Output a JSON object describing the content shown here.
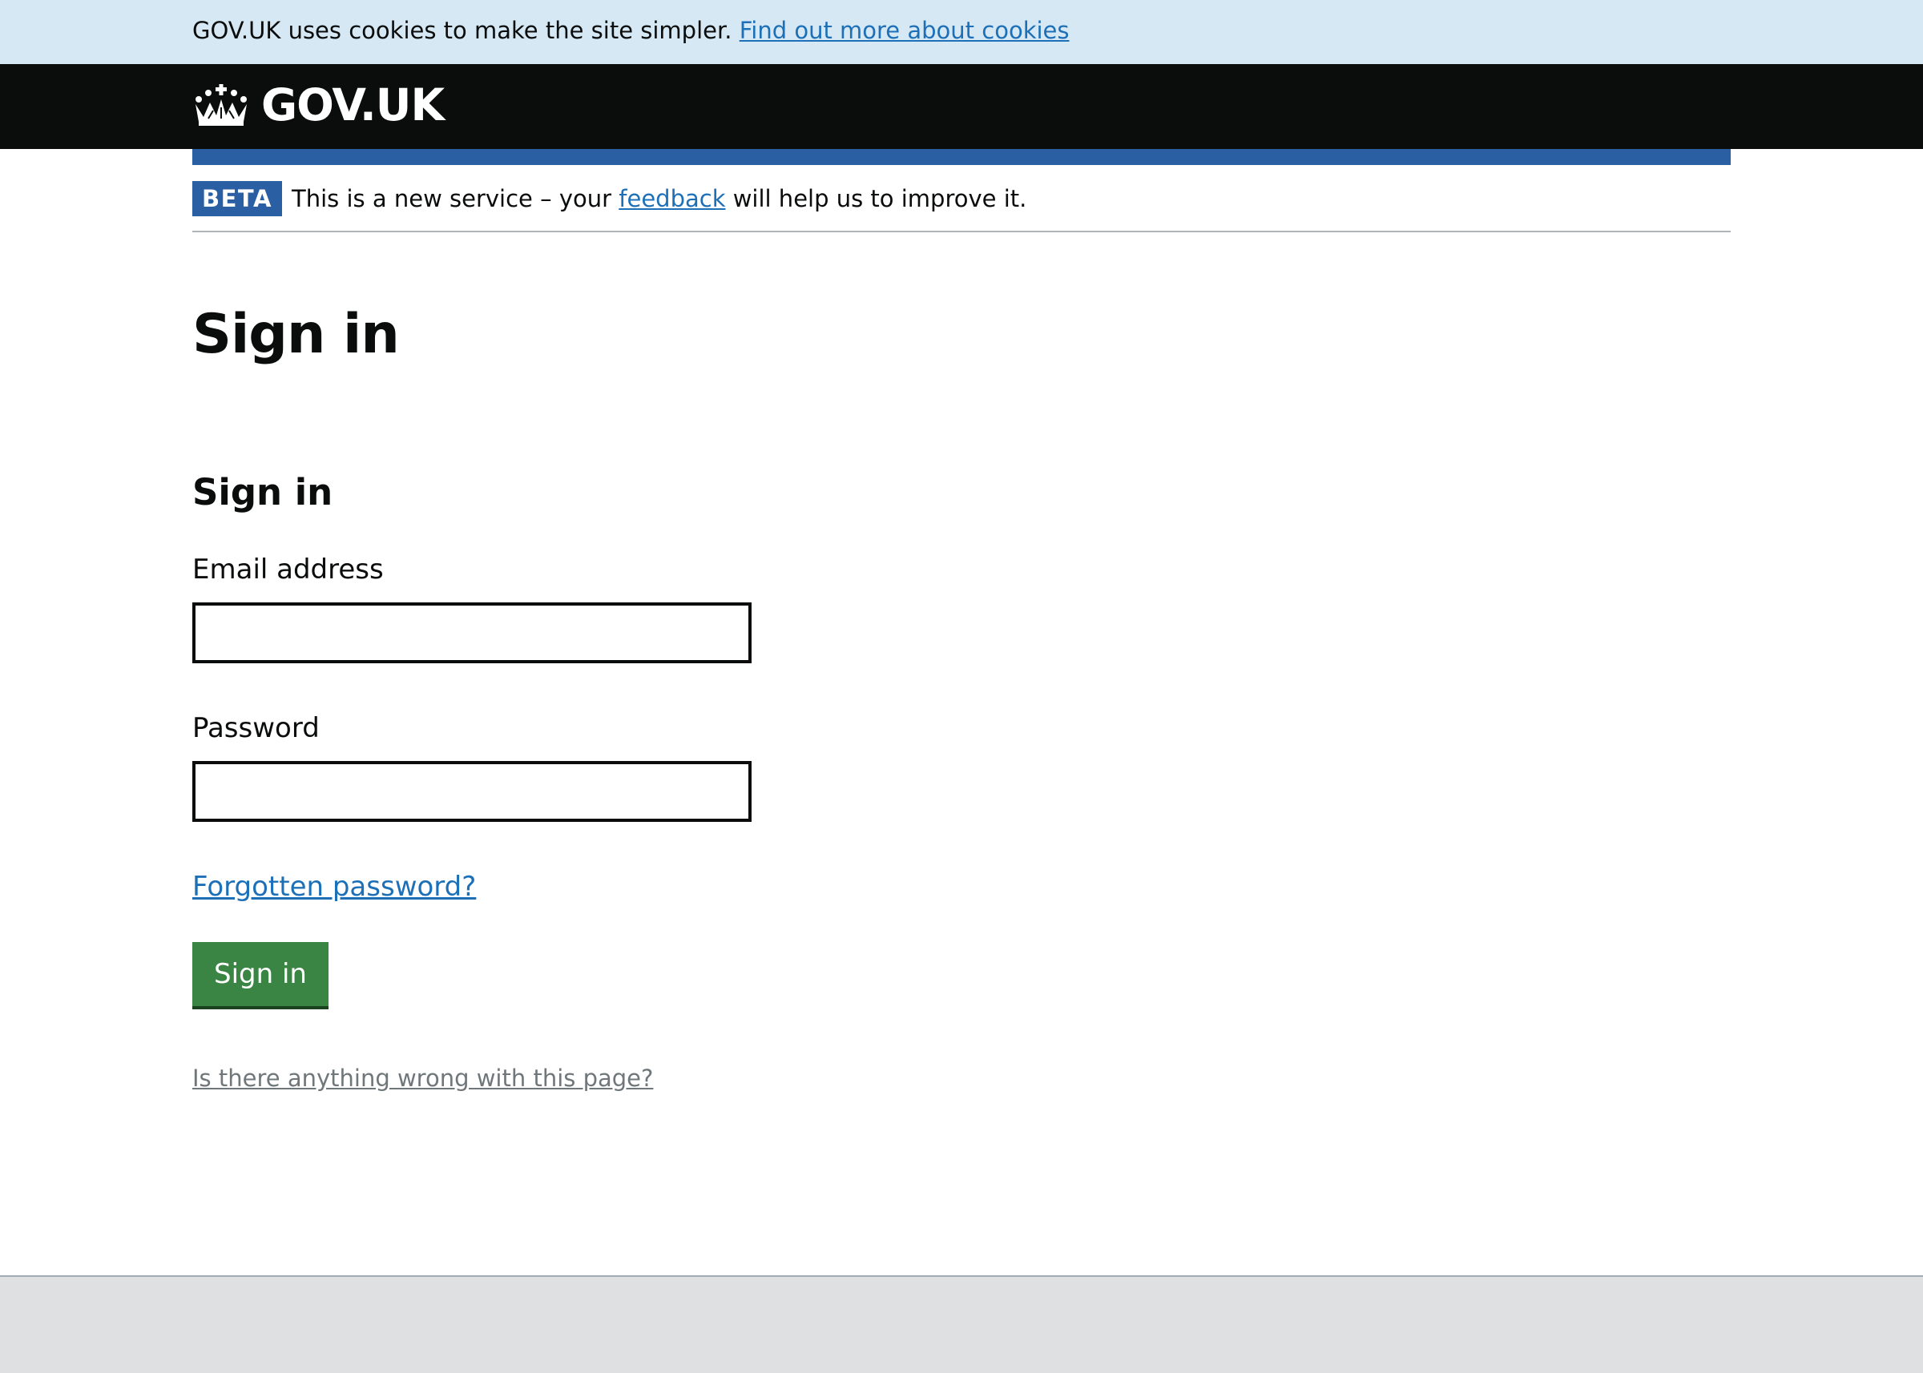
{
  "cookie_banner": {
    "text": "GOV.UK uses cookies to make the site simpler.",
    "link_label": "Find out more about cookies"
  },
  "header": {
    "logo_text": "GOV.UK",
    "logo_icon": "crown-icon"
  },
  "phase_banner": {
    "tag": "BETA",
    "text_before": "This is a new service – your",
    "link_label": "feedback",
    "text_after": "will help us to improve it."
  },
  "page": {
    "title": "Sign in"
  },
  "form": {
    "heading": "Sign in",
    "email_label": "Email address",
    "email_value": "",
    "password_label": "Password",
    "password_value": "",
    "forgot_label": "Forgotten password?",
    "submit_label": "Sign in"
  },
  "report_link": "Is there anything wrong with this page?",
  "colors": {
    "cookie_banner_bg": "#d5e8f3",
    "header_bg": "#0b0c0c",
    "brand_blue": "#2b5fa4",
    "link": "#1d70b8",
    "button_green": "#3a8444",
    "footer_bg": "#dee0e2"
  }
}
